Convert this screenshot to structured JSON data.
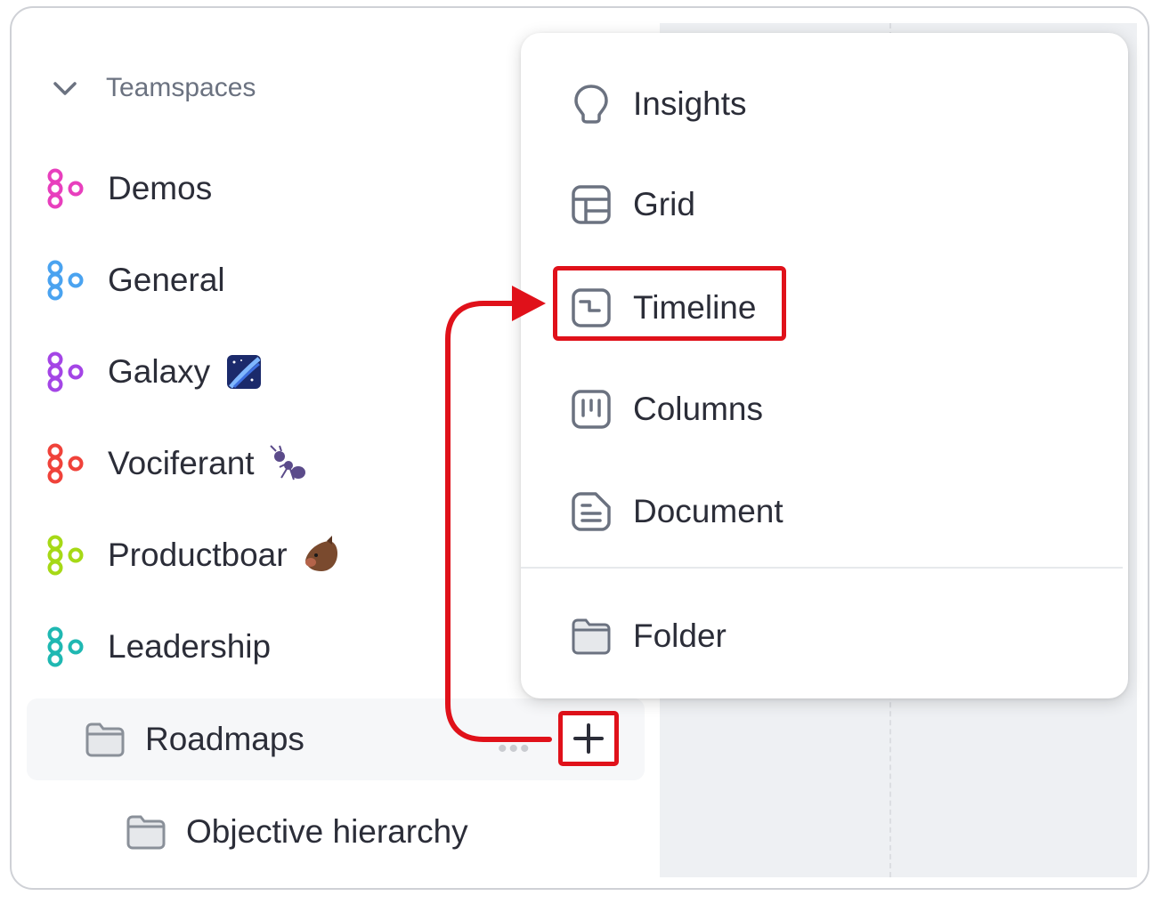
{
  "sidebar": {
    "section_label": "Teamspaces",
    "teamspaces": [
      {
        "label": "Demos",
        "color": "#e83fbd"
      },
      {
        "label": "General",
        "color": "#4aa3f0"
      },
      {
        "label": "Galaxy",
        "color": "#a445e6",
        "emoji": "galaxy-emoji"
      },
      {
        "label": "Vociferant",
        "color": "#f0423a",
        "emoji": "ant-emoji"
      },
      {
        "label": "Productboar",
        "color": "#a6d916",
        "emoji": "boar-emoji"
      },
      {
        "label": "Leadership",
        "color": "#1fb8b2"
      }
    ],
    "folders": [
      {
        "label": "Roadmaps"
      },
      {
        "label": "Objective hierarchy"
      }
    ]
  },
  "menu": {
    "items": [
      {
        "label": "Insights",
        "icon": "lightbulb-icon"
      },
      {
        "label": "Grid",
        "icon": "grid-icon"
      },
      {
        "label": "Timeline",
        "icon": "timeline-icon"
      },
      {
        "label": "Columns",
        "icon": "columns-icon"
      },
      {
        "label": "Document",
        "icon": "document-icon"
      },
      {
        "label": "Folder",
        "icon": "folder-icon"
      }
    ]
  },
  "annotation": {
    "color": "#e0111a"
  },
  "colors": {
    "text": "#2b2d38",
    "muted": "#6b7280",
    "icon": "#6b7280"
  }
}
